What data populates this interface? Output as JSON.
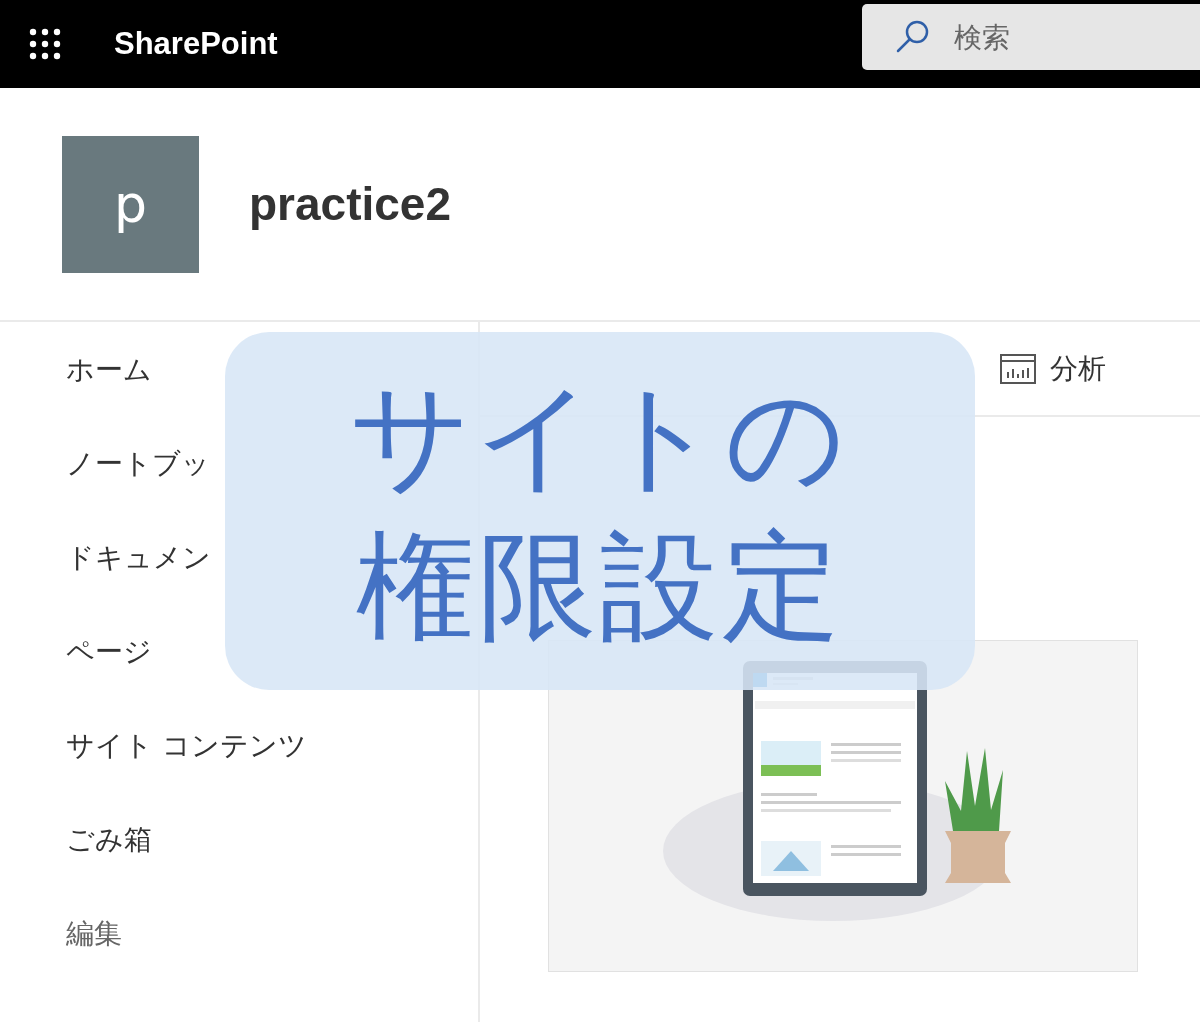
{
  "top_bar": {
    "app_name": "SharePoint",
    "search": {
      "placeholder": "検索"
    }
  },
  "site": {
    "logo_letter": "p",
    "title": "practice2"
  },
  "nav": {
    "items": [
      {
        "label": "ホーム",
        "kind": "page"
      },
      {
        "label": "ノートブッ",
        "kind": "page"
      },
      {
        "label": "ドキュメン",
        "kind": "page"
      },
      {
        "label": "ページ",
        "kind": "page"
      },
      {
        "label": "サイト コンテンツ",
        "kind": "page"
      },
      {
        "label": "ごみ箱",
        "kind": "page"
      },
      {
        "label": "編集",
        "kind": "edit"
      }
    ]
  },
  "command_bar": [
    {
      "label": "分析",
      "kind": "analytics"
    }
  ],
  "overlay": {
    "title_lines": [
      "サイトの",
      "権限設定"
    ]
  }
}
